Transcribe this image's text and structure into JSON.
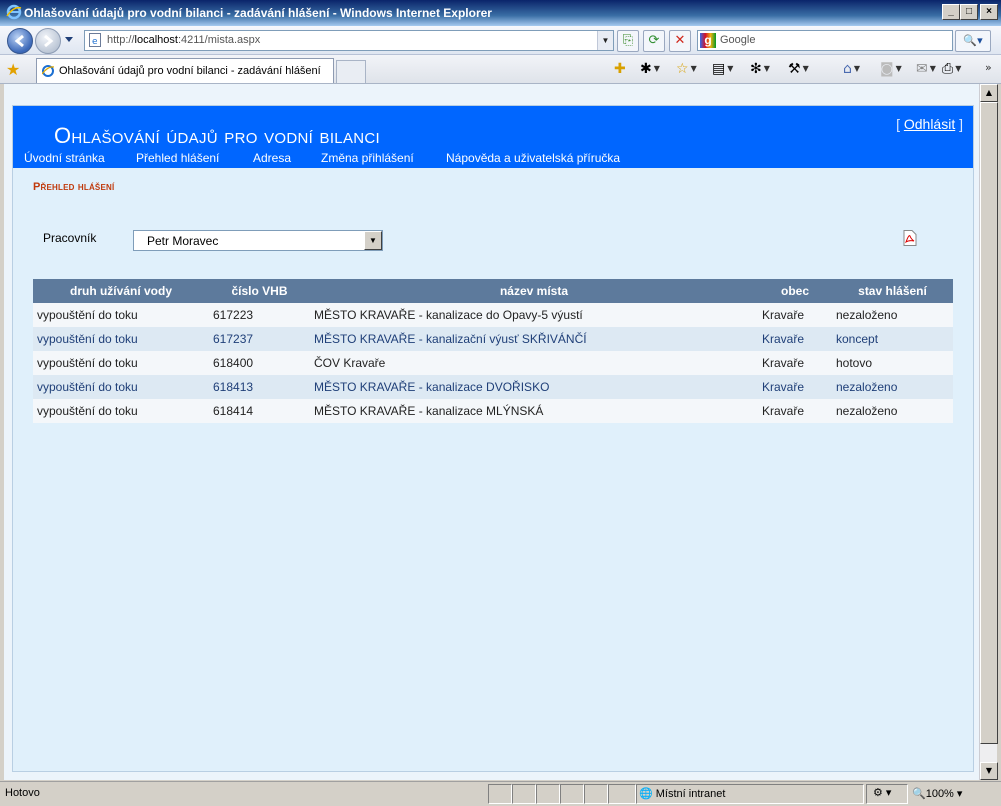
{
  "window": {
    "title": "Ohlašování údajů pro vodní bilanci - zadávání hlášení - Windows Internet Explorer",
    "min_glyph": "_",
    "max_glyph": "□",
    "close_glyph": "×"
  },
  "address_bar": {
    "url_prefix": "http://",
    "url_host": "localhost",
    "url_rest": ":4211/mista.aspx"
  },
  "search": {
    "placeholder": "Google",
    "button_glyph": "🔍▾"
  },
  "tab": {
    "label": "Ohlašování údajů pro vodní bilanci - zadávání hlášení"
  },
  "app": {
    "title": "Ohlašování údajů pro vodní bilanci",
    "logout_open": "[ ",
    "logout_label": "Odhlásit",
    "logout_close": " ]",
    "menu": [
      "Úvodní stránka",
      "Přehled hlášení",
      "Adresa",
      "Změna přihlášení",
      "Nápověda a uživatelská příručka"
    ]
  },
  "page": {
    "section_title": "Přehled hlášení",
    "worker_label": "Pracovník",
    "worker_value": "Petr Moravec"
  },
  "table": {
    "headers": [
      "druh užívání vody",
      "číslo VHB",
      "název místa",
      "obec",
      "stav hlášení"
    ],
    "rows": [
      [
        "vypouštění do toku",
        "617223",
        "MĚSTO KRAVAŘE - kanalizace do Opavy-5 výustí",
        "Kravaře",
        "nezaloženo"
      ],
      [
        "vypouštění do toku",
        "617237",
        "MĚSTO KRAVAŘE - kanalizační výusť SKŘIVÁNČÍ",
        "Kravaře",
        "koncept"
      ],
      [
        "vypouštění do toku",
        "618400",
        "ČOV Kravaře",
        "Kravaře",
        "hotovo"
      ],
      [
        "vypouštění do toku",
        "618413",
        "MĚSTO KRAVAŘE - kanalizace DVOŘISKO",
        "Kravaře",
        "nezaloženo"
      ],
      [
        "vypouštění do toku",
        "618414",
        "MĚSTO KRAVAŘE - kanalizace MLÝNSKÁ",
        "Kravaře",
        "nezaloženo"
      ]
    ]
  },
  "status_bar": {
    "status": "Hotovo",
    "zone": "Místní intranet",
    "zoom": "100%"
  },
  "colors": {
    "header_bg": "#0066ff",
    "content_bg": "#e0f0fb",
    "table_header_bg": "#5d7a9c",
    "section_title": "#c0390b"
  }
}
